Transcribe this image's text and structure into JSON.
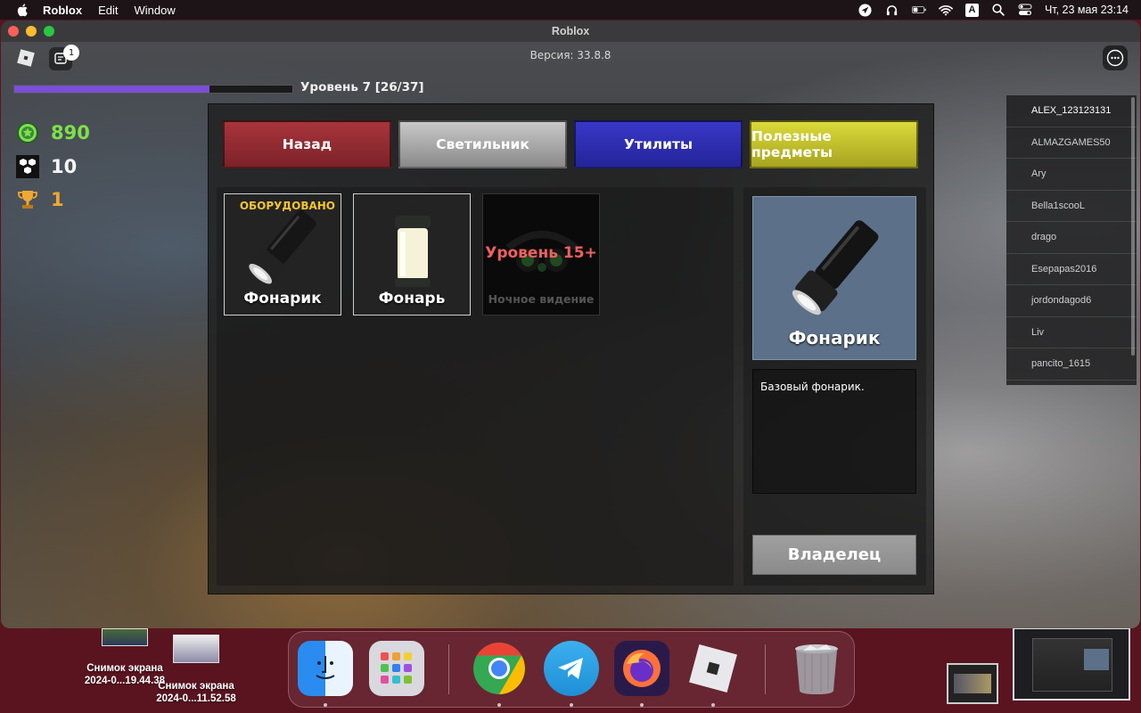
{
  "menubar": {
    "app_name": "Roblox",
    "menus": [
      "Edit",
      "Window"
    ],
    "datetime": "Чт, 23 мая  23:14",
    "input_source": "A"
  },
  "window": {
    "title": "Roblox"
  },
  "hud": {
    "version": "Версия: 33.8.8",
    "chat_badge": "1",
    "level_label": "Уровень 7 [26/37]",
    "xp_fraction": 0.703,
    "coins": "890",
    "hex_points": "10",
    "trophies": "1"
  },
  "players": [
    "ALEX_123123131",
    "ALMAZGAMES50",
    "Ary",
    "Bella1scooL",
    "drago",
    "Esepapas2016",
    "jordondagod6",
    "Liv",
    "pancito_1615"
  ],
  "shop": {
    "tabs": {
      "back": "Назад",
      "light": "Светильник",
      "utilities": "Утилиты",
      "useful": "Полезные предметы"
    },
    "items": [
      {
        "name": "Фонарик",
        "badge": "ОБОРУДОВАНО"
      },
      {
        "name": "Фонарь"
      },
      {
        "name": "Ночное видение",
        "lock": "Уровень 15+"
      }
    ],
    "detail": {
      "name": "Фонарик",
      "description": "Базовый фонарик.",
      "owner_button": "Владелец"
    }
  },
  "desktop": {
    "files": [
      {
        "line1": "Снимок экрана",
        "line2": "2024-0...19.44.38"
      },
      {
        "line1": "Снимок экрана",
        "line2": "2024-0...11.52.58"
      }
    ]
  },
  "dock": {
    "apps": [
      "finder-icon",
      "launchpad-icon",
      "chrome-icon",
      "telegram-icon",
      "firefox-icon",
      "roblox-icon",
      "trash-icon"
    ]
  },
  "colors": {
    "xp_fill": "#7a4fd6",
    "coins": "#7ee04a",
    "trophy": "#f0a830",
    "tab_back": "#a8353c",
    "tab_util": "#3838c8",
    "tab_useful": "#dada3a",
    "lock_text": "#f06060",
    "equipped": "#f4c430"
  }
}
